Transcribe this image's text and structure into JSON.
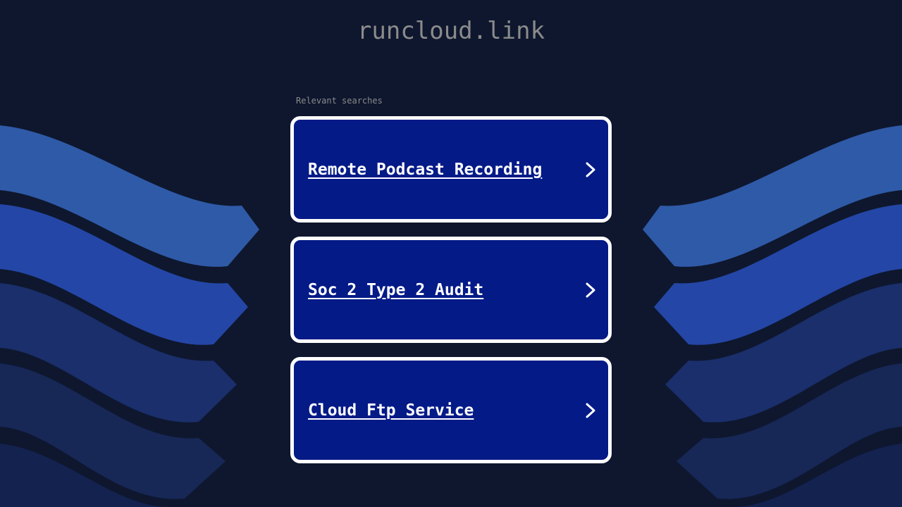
{
  "header": {
    "domain": "runcloud.link"
  },
  "searches": {
    "label": "Relevant searches",
    "items": [
      {
        "label": "Remote Podcast Recording"
      },
      {
        "label": "Soc 2 Type 2 Audit"
      },
      {
        "label": "Cloud Ftp Service"
      }
    ]
  },
  "icons": {
    "chevron": "chevron-right-icon"
  },
  "colors": {
    "background": "#0e172e",
    "card_background": "#031a87",
    "card_border": "#ffffff",
    "title_text": "#8b8b8b",
    "wave_light": "#2f5aa8",
    "wave_mid": "#2446a6",
    "wave_dark": "#1a2f6b",
    "wave_darker": "#172756"
  }
}
